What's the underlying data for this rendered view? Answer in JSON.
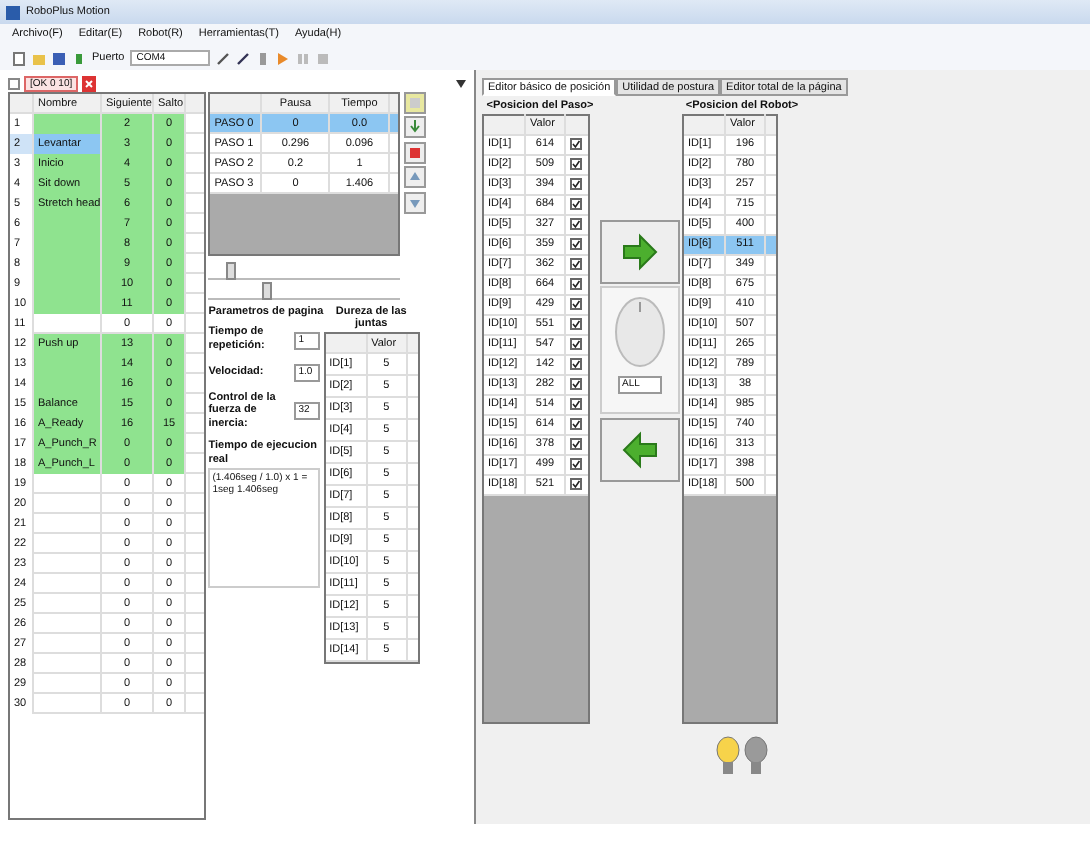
{
  "window": {
    "title": "RoboPlus Motion"
  },
  "menu": [
    "Archivo(F)",
    "Editar(E)",
    "Robot(R)",
    "Herramientas(T)",
    "Ayuda(H)"
  ],
  "toolbar": {
    "port_label": "Puerto",
    "port_value": "COM4"
  },
  "file_tab": {
    "label": "[OK 0 10]"
  },
  "pages_table": {
    "columns": [
      "Nombre",
      "Siguiente",
      "Salto"
    ],
    "rows": [
      {
        "number": "1",
        "next": "2",
        "jump": "0",
        "active": true,
        "selected": false
      },
      {
        "number": "2",
        "name": "Levantar",
        "next": "3",
        "jump": "0",
        "active": true,
        "selected": true
      },
      {
        "number": "3",
        "name": "Inicio",
        "next": "4",
        "jump": "0",
        "active": true,
        "selected": false
      },
      {
        "number": "4",
        "name": "Sit down",
        "next": "5",
        "jump": "0",
        "active": true,
        "selected": false
      },
      {
        "number": "5",
        "name": "Stretch head",
        "next": "6",
        "jump": "0",
        "active": true,
        "selected": false
      },
      {
        "number": "6",
        "next": "7",
        "jump": "0",
        "active": true,
        "selected": false
      },
      {
        "number": "7",
        "next": "8",
        "jump": "0",
        "active": true,
        "selected": false
      },
      {
        "number": "8",
        "next": "9",
        "jump": "0",
        "active": true,
        "selected": false
      },
      {
        "number": "9",
        "next": "10",
        "jump": "0",
        "active": true,
        "selected": false
      },
      {
        "number": "10",
        "next": "11",
        "jump": "0",
        "active": true,
        "selected": false
      },
      {
        "number": "11",
        "next": "0",
        "jump": "0",
        "active": false,
        "selected": false
      },
      {
        "number": "12",
        "name": "Push up",
        "next": "13",
        "jump": "0",
        "active": true,
        "selected": false
      },
      {
        "number": "13",
        "next": "14",
        "jump": "0",
        "active": true,
        "selected": false
      },
      {
        "number": "14",
        "next": "16",
        "jump": "0",
        "active": true,
        "selected": false
      },
      {
        "number": "15",
        "name": "Balance",
        "next": "15",
        "jump": "0",
        "active": true,
        "selected": false
      },
      {
        "number": "16",
        "name": "A_Ready",
        "next": "16",
        "jump": "15",
        "active": true,
        "selected": false
      },
      {
        "number": "17",
        "name": "A_Punch_R",
        "next": "0",
        "jump": "0",
        "active": true,
        "selected": false
      },
      {
        "number": "18",
        "name": "A_Punch_L",
        "next": "0",
        "jump": "0",
        "active": true,
        "selected": false
      },
      {
        "number": "19",
        "next": "0",
        "jump": "0",
        "active": false,
        "selected": false
      },
      {
        "number": "20",
        "next": "0",
        "jump": "0",
        "active": false,
        "selected": false
      },
      {
        "number": "21",
        "next": "0",
        "jump": "0",
        "active": false,
        "selected": false
      },
      {
        "number": "22",
        "next": "0",
        "jump": "0",
        "active": false,
        "selected": false
      },
      {
        "number": "23",
        "next": "0",
        "jump": "0",
        "active": false,
        "selected": false
      },
      {
        "number": "24",
        "next": "0",
        "jump": "0",
        "active": false,
        "selected": false
      },
      {
        "number": "25",
        "next": "0",
        "jump": "0",
        "active": false,
        "selected": false
      },
      {
        "number": "26",
        "next": "0",
        "jump": "0",
        "active": false,
        "selected": false
      },
      {
        "number": "27",
        "next": "0",
        "jump": "0",
        "active": false,
        "selected": false
      },
      {
        "number": "28",
        "next": "0",
        "jump": "0",
        "active": false,
        "selected": false
      },
      {
        "number": "29",
        "next": "0",
        "jump": "0",
        "active": false,
        "selected": false
      },
      {
        "number": "30",
        "next": "0",
        "jump": "0",
        "active": false,
        "selected": false
      }
    ]
  },
  "steps_table": {
    "columns": [
      "Pausa",
      "Tiempo"
    ],
    "rows": [
      {
        "label": "PASO 0",
        "pause": "0",
        "time": "0.0",
        "selected": true
      },
      {
        "label": "PASO 1",
        "pause": "0.296",
        "time": "0.096",
        "selected": false
      },
      {
        "label": "PASO 2",
        "pause": "0.2",
        "time": "1",
        "selected": false
      },
      {
        "label": "PASO 3",
        "pause": "0",
        "time": "1.406",
        "selected": false
      }
    ]
  },
  "sliders": [
    {
      "level": 0.1
    },
    {
      "level": 0.3
    }
  ],
  "page_parameters": {
    "title": "Parametros de pagina",
    "fields": [
      {
        "label": "Tiempo de repetición:",
        "value": "1"
      },
      {
        "label": "Velocidad:",
        "value": "1.0"
      },
      {
        "label": "Control de la fuerza de inercia:",
        "value": "32"
      }
    ],
    "real_time_label": "Tiempo de ejecucion real",
    "real_time_value": "(1.406seg / 1.0) x 1 = 1seg 1.406seg"
  },
  "joint_compliance": {
    "title": "Dureza de las juntas",
    "column": "Valor",
    "rows": [
      {
        "id": "ID[1]",
        "value": "5"
      },
      {
        "id": "ID[2]",
        "value": "5"
      },
      {
        "id": "ID[3]",
        "value": "5"
      },
      {
        "id": "ID[4]",
        "value": "5"
      },
      {
        "id": "ID[5]",
        "value": "5"
      },
      {
        "id": "ID[6]",
        "value": "5"
      },
      {
        "id": "ID[7]",
        "value": "5"
      },
      {
        "id": "ID[8]",
        "value": "5"
      },
      {
        "id": "ID[9]",
        "value": "5"
      },
      {
        "id": "ID[10]",
        "value": "5"
      },
      {
        "id": "ID[11]",
        "value": "5"
      },
      {
        "id": "ID[12]",
        "value": "5"
      },
      {
        "id": "ID[13]",
        "value": "5"
      },
      {
        "id": "ID[14]",
        "value": "5"
      }
    ]
  },
  "editor_tabs": [
    {
      "label": "Editor básico de posición",
      "selected": true
    },
    {
      "label": "Utilidad de postura",
      "selected": false
    },
    {
      "label": "Editor total de la página",
      "selected": false
    }
  ],
  "step_pose": {
    "title": "<Posicion del Paso>",
    "column": "Valor",
    "rows": [
      {
        "id": "ID[1]",
        "value": "614",
        "checked": true
      },
      {
        "id": "ID[2]",
        "value": "509",
        "checked": true
      },
      {
        "id": "ID[3]",
        "value": "394",
        "checked": true
      },
      {
        "id": "ID[4]",
        "value": "684",
        "checked": true
      },
      {
        "id": "ID[5]",
        "value": "327",
        "checked": true
      },
      {
        "id": "ID[6]",
        "value": "359",
        "checked": true
      },
      {
        "id": "ID[7]",
        "value": "362",
        "checked": true
      },
      {
        "id": "ID[8]",
        "value": "664",
        "checked": true
      },
      {
        "id": "ID[9]",
        "value": "429",
        "checked": true
      },
      {
        "id": "ID[10]",
        "value": "551",
        "checked": true
      },
      {
        "id": "ID[11]",
        "value": "547",
        "checked": true
      },
      {
        "id": "ID[12]",
        "value": "142",
        "checked": true
      },
      {
        "id": "ID[13]",
        "value": "282",
        "checked": true
      },
      {
        "id": "ID[14]",
        "value": "514",
        "checked": true
      },
      {
        "id": "ID[15]",
        "value": "614",
        "checked": true
      },
      {
        "id": "ID[16]",
        "value": "378",
        "checked": true
      },
      {
        "id": "ID[17]",
        "value": "499",
        "checked": true
      },
      {
        "id": "ID[18]",
        "value": "521",
        "checked": true
      }
    ]
  },
  "knob": {
    "value": "ALL"
  },
  "robot_pose": {
    "title": "<Posicion del Robot>",
    "column": "Valor",
    "rows": [
      {
        "id": "ID[1]",
        "value": "196",
        "selected": false
      },
      {
        "id": "ID[2]",
        "value": "780",
        "selected": false
      },
      {
        "id": "ID[3]",
        "value": "257",
        "selected": false
      },
      {
        "id": "ID[4]",
        "value": "715",
        "selected": false
      },
      {
        "id": "ID[5]",
        "value": "400",
        "selected": false
      },
      {
        "id": "ID[6]",
        "value": "511",
        "selected": true
      },
      {
        "id": "ID[7]",
        "value": "349",
        "selected": false
      },
      {
        "id": "ID[8]",
        "value": "675",
        "selected": false
      },
      {
        "id": "ID[9]",
        "value": "410",
        "selected": false
      },
      {
        "id": "ID[10]",
        "value": "507",
        "selected": false
      },
      {
        "id": "ID[11]",
        "value": "265",
        "selected": false
      },
      {
        "id": "ID[12]",
        "value": "789",
        "selected": false
      },
      {
        "id": "ID[13]",
        "value": "38",
        "selected": false
      },
      {
        "id": "ID[14]",
        "value": "985",
        "selected": false
      },
      {
        "id": "ID[15]",
        "value": "740",
        "selected": false
      },
      {
        "id": "ID[16]",
        "value": "313",
        "selected": false
      },
      {
        "id": "ID[17]",
        "value": "398",
        "selected": false
      },
      {
        "id": "ID[18]",
        "value": "500",
        "selected": false
      }
    ]
  },
  "lights": [
    {
      "on": true
    },
    {
      "on": false
    }
  ]
}
